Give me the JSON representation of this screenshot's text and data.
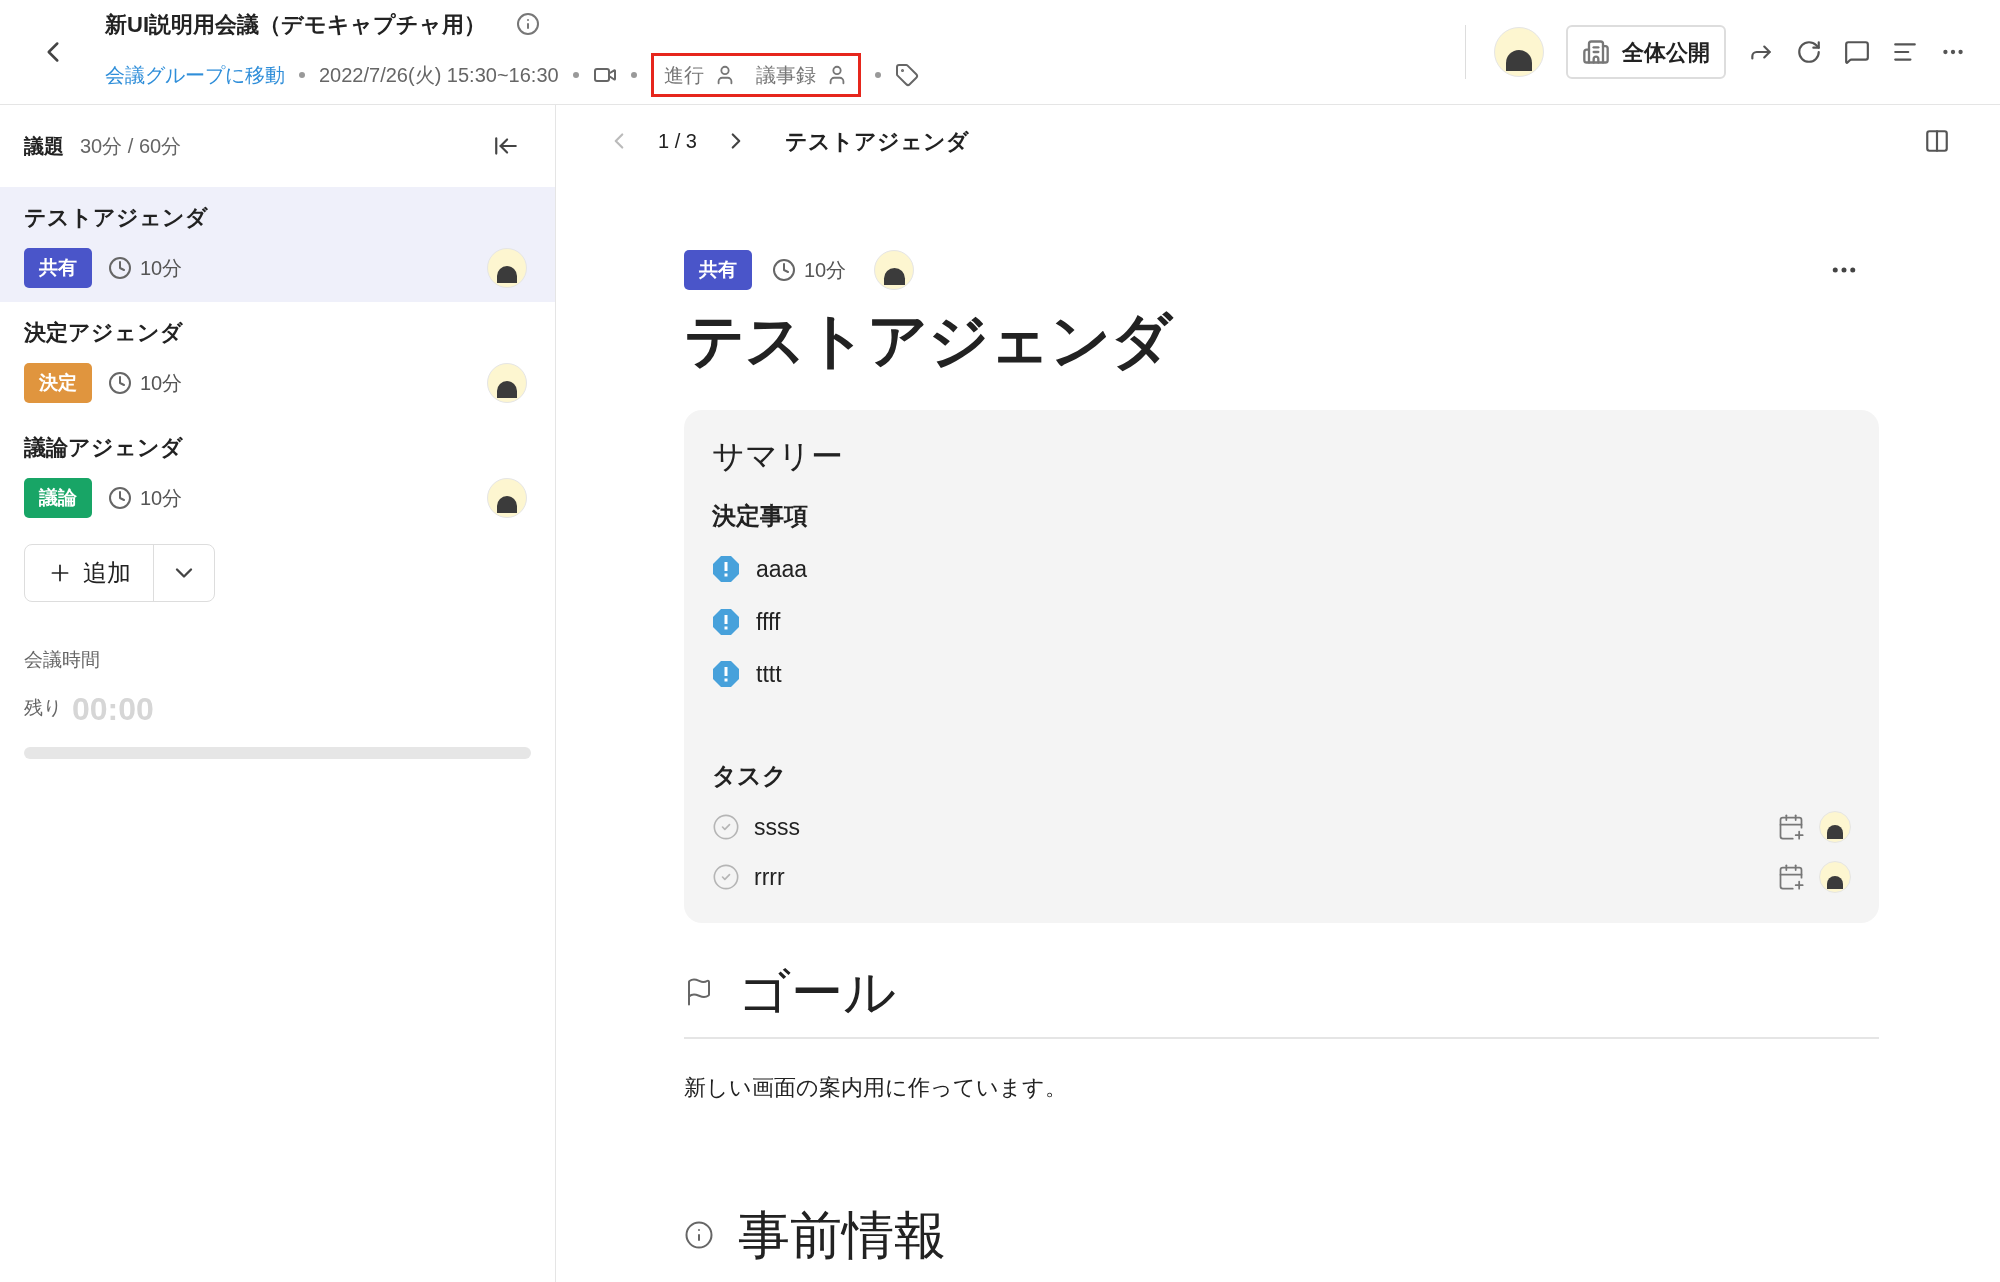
{
  "header": {
    "title": "新UI説明用会議（デモキャプチャ用）",
    "group_link": "会議グループに移動",
    "datetime": "2022/7/26(火) 15:30~16:30",
    "roles": [
      {
        "label": "進行"
      },
      {
        "label": "議事録"
      }
    ],
    "roles_highlighted": true,
    "visibility_button": "全体公開"
  },
  "sidebar": {
    "heading": "議題",
    "time_summary": "30分 / 60分",
    "items": [
      {
        "title": "テストアジェンダ",
        "tag": "共有",
        "color": "#4a55c9",
        "duration": "10分",
        "selected": true
      },
      {
        "title": "決定アジェンダ",
        "tag": "決定",
        "color": "#e0953e",
        "duration": "10分",
        "selected": false
      },
      {
        "title": "議論アジェンダ",
        "tag": "議論",
        "color": "#18a566",
        "duration": "10分",
        "selected": false
      }
    ],
    "add_button": "追加",
    "meeting_time_label": "会議時間",
    "remaining_label": "残り",
    "remaining_time": "00:00"
  },
  "content": {
    "pager": "1 / 3",
    "pager_title": "テストアジェンダ",
    "tag": {
      "label": "共有",
      "color": "#4a55c9"
    },
    "duration": "10分",
    "title": "テストアジェンダ",
    "summary": {
      "title": "サマリー",
      "decisions_heading": "決定事項",
      "decisions": [
        "aaaa",
        "ffff",
        "tttt"
      ],
      "tasks_heading": "タスク",
      "tasks": [
        {
          "text": "ssss",
          "checked": false
        },
        {
          "text": "rrrr",
          "checked": false
        }
      ]
    },
    "goal_heading": "ゴール",
    "goal_text": "新しい画面の案内用に作っています。",
    "info_heading": "事前情報"
  }
}
